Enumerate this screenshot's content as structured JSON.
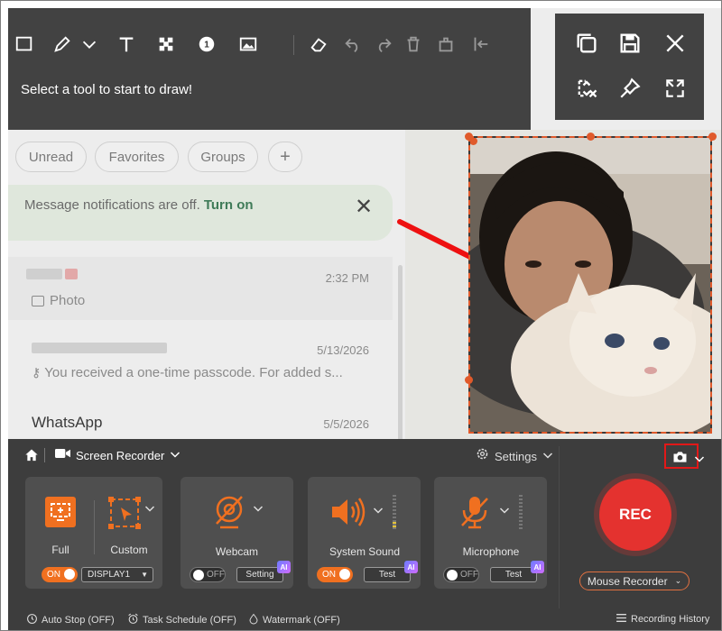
{
  "chat": {
    "filters": [
      "Unread",
      "Favorites",
      "Groups",
      "+"
    ],
    "notification": {
      "text": "Message notifications are off.",
      "action": "Turn on"
    },
    "rows": [
      {
        "preview": "Photo",
        "time": "2:32 PM"
      },
      {
        "preview": "You received a one-time passcode. For added s...",
        "time": "5/13/2026"
      },
      {
        "name": "WhatsApp",
        "time": "5/5/2026"
      }
    ]
  },
  "drawbar": {
    "hint": "Select a tool to start to draw!",
    "step_badge": "1"
  },
  "recorder": {
    "mode": "Screen Recorder",
    "settings": "Settings",
    "full": {
      "label": "Full",
      "toggle": "ON"
    },
    "custom": {
      "label": "Custom",
      "display": "DISPLAY1"
    },
    "webcam": {
      "label": "Webcam",
      "toggle": "OFF",
      "button": "Setting"
    },
    "system_sound": {
      "label": "System Sound",
      "toggle": "ON",
      "button": "Test"
    },
    "microphone": {
      "label": "Microphone",
      "toggle": "OFF",
      "button": "Test"
    },
    "ai_badge": "AI",
    "rec": "REC",
    "mouse_recorder": "Mouse Recorder",
    "bottom": {
      "auto_stop": "Auto Stop (OFF)",
      "task_schedule": "Task Schedule (OFF)",
      "watermark": "Watermark (OFF)",
      "history": "Recording History"
    }
  },
  "colors": {
    "accent": "#f07020",
    "rec": "#e4322f",
    "panel": "#3d3d3d",
    "toolbar": "#424242"
  }
}
